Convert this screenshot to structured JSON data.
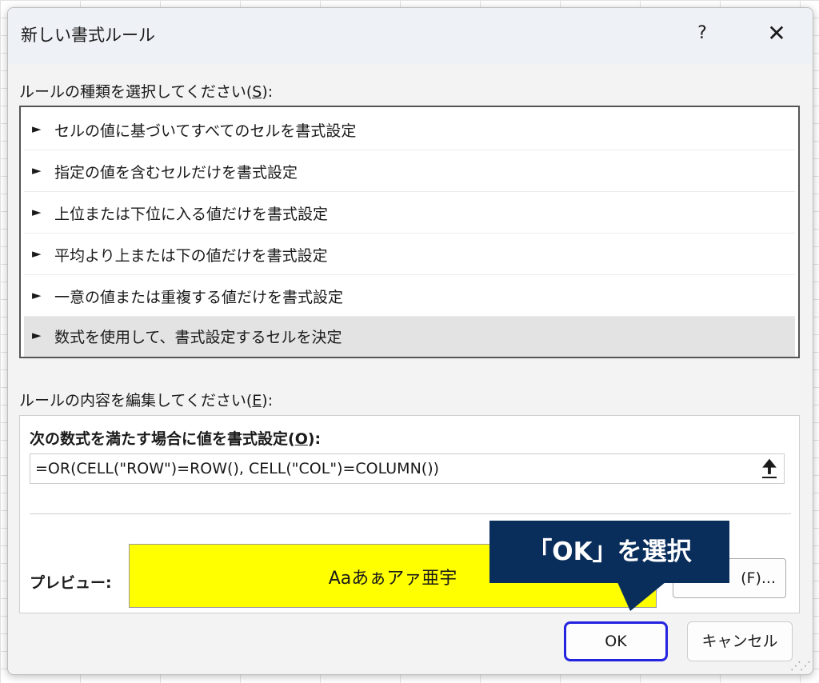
{
  "window": {
    "title": "新しい書式ルール",
    "help": "?",
    "close": "✕"
  },
  "rule_type": {
    "label_pre": "ルールの種類を選択してください(",
    "label_key": "S",
    "label_post": "):",
    "arrow": "►",
    "items": [
      {
        "label": "セルの値に基づいてすべてのセルを書式設定",
        "selected": false
      },
      {
        "label": "指定の値を含むセルだけを書式設定",
        "selected": false
      },
      {
        "label": "上位または下位に入る値だけを書式設定",
        "selected": false
      },
      {
        "label": "平均より上または下の値だけを書式設定",
        "selected": false
      },
      {
        "label": "一意の値または重複する値だけを書式設定",
        "selected": false
      },
      {
        "label": "数式を使用して、書式設定するセルを決定",
        "selected": true
      }
    ]
  },
  "rule_edit": {
    "label_pre": "ルールの内容を編集してください(",
    "label_key": "E",
    "label_post": "):",
    "formula_label_pre": "次の数式を満たす場合に値を書式設定(",
    "formula_label_key": "O",
    "formula_label_post": "):",
    "formula_value": "=OR(CELL(\"ROW\")=ROW(), CELL(\"COL\")=COLUMN())",
    "collapse_icon": "🠉"
  },
  "preview": {
    "label": "プレビュー:",
    "sample_text": "Aaあぁアァ亜宇",
    "fill_color": "#ffff00",
    "format_button_partial": "(F)..."
  },
  "buttons": {
    "ok": "OK",
    "cancel": "キャンセル"
  },
  "callout": {
    "text": "「OK」を選択",
    "color": "#0a2e5c"
  }
}
